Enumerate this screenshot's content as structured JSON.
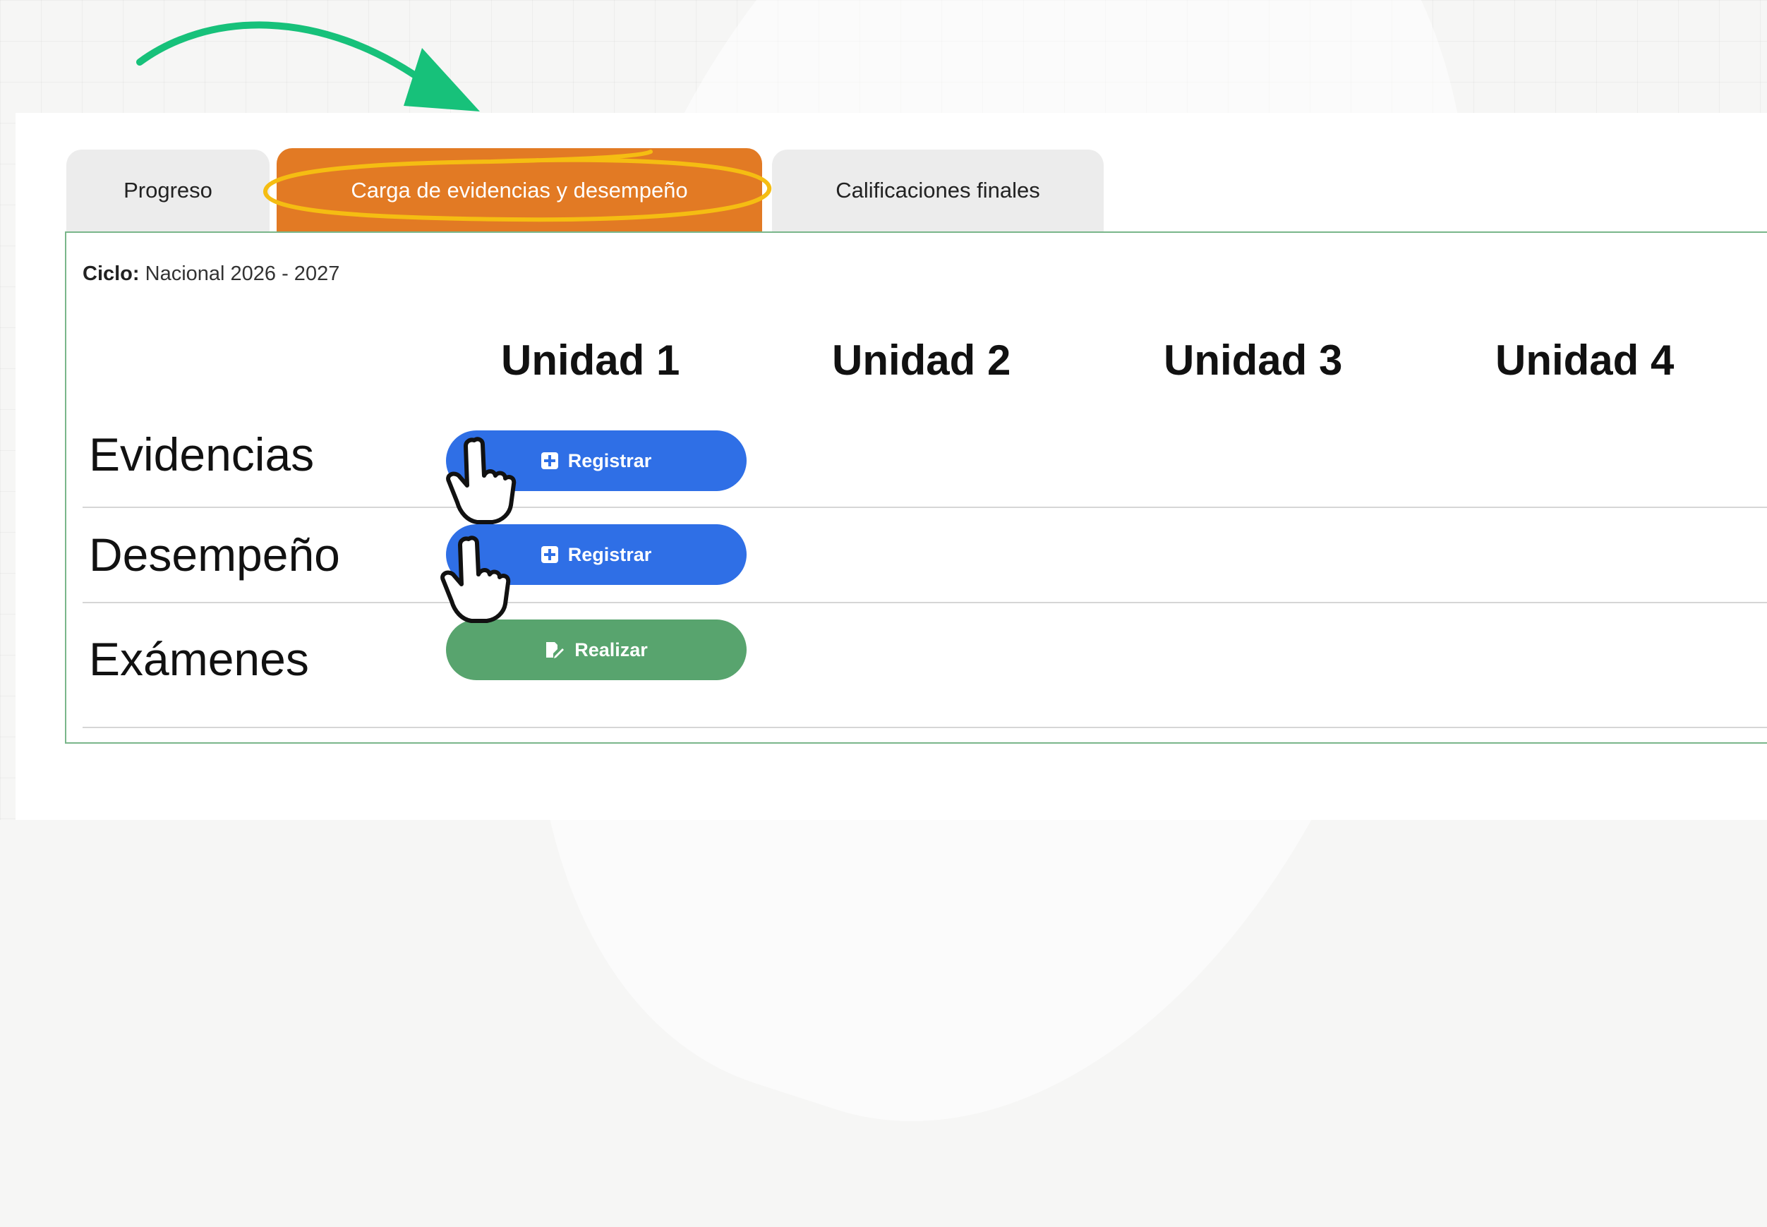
{
  "tabs": [
    {
      "label": "Progreso",
      "active": false
    },
    {
      "label": "Carga de evidencias y desempeño",
      "active": true
    },
    {
      "label": "Calificaciones finales",
      "active": false
    }
  ],
  "cycle": {
    "label": "Ciclo:",
    "value": "Nacional 2026 - 2027"
  },
  "units": [
    "Unidad 1",
    "Unidad 2",
    "Unidad 3",
    "Unidad 4"
  ],
  "rows": [
    {
      "label": "Evidencias",
      "button_label": "Registrar",
      "button_icon": "plus-square-icon",
      "button_color": "#2f6fe6"
    },
    {
      "label": "Desempeño",
      "button_label": "Registrar",
      "button_icon": "plus-square-icon",
      "button_color": "#2f6fe6"
    },
    {
      "label": "Exámenes",
      "button_label": "Realizar",
      "button_icon": "edit-document-icon",
      "button_color": "#58a46e"
    }
  ],
  "colors": {
    "active_tab": "#e27a24",
    "highlight": "#f5bd12",
    "arrow": "#17c17a",
    "panel_border": "#79b68a"
  }
}
